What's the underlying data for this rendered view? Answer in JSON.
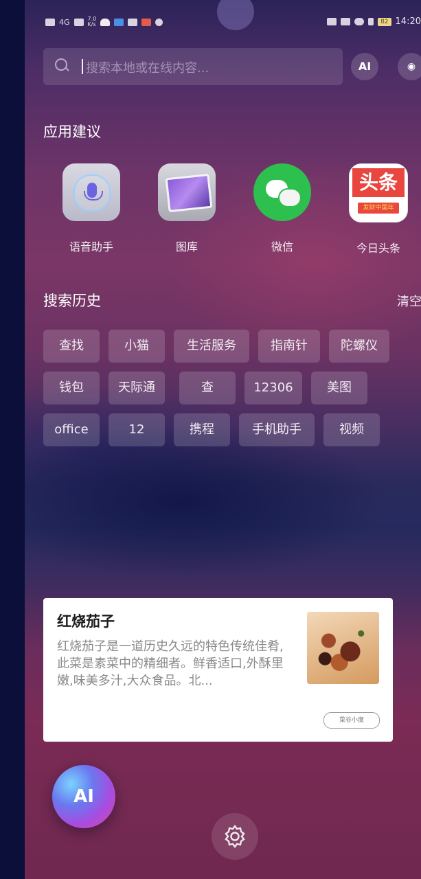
{
  "status_bar": {
    "left_text": "4G",
    "net_speed": "7.0\nK/s",
    "battery": "82",
    "time": "14:20"
  },
  "search": {
    "placeholder": "搜索本地或在线内容...",
    "ai_label": "AI",
    "right_icon": "eye-icon"
  },
  "app_suggestions": {
    "title": "应用建议",
    "apps": [
      {
        "label": "语音助手",
        "icon": "microphone-icon"
      },
      {
        "label": "图库",
        "icon": "gallery-icon"
      },
      {
        "label": "微信",
        "icon": "wechat-icon"
      },
      {
        "label": "今日头条",
        "icon": "toutiao-icon",
        "icon_text": "头条",
        "icon_subtext": "发财中国年"
      }
    ]
  },
  "history": {
    "title": "搜索历史",
    "clear_label": "清空",
    "items": [
      "查找",
      "小猫",
      "生活服务",
      "指南针",
      "陀螺仪",
      "钱包",
      "天际通",
      "查",
      "12306",
      "美图",
      "office",
      "12",
      "携程",
      "手机助手",
      "视频"
    ]
  },
  "card": {
    "title": "红烧茄子",
    "description": "红烧茄子是一道历史久远的特色传统佳肴,此菜是素菜中的精细者。鲜香适口,外酥里嫩,味美多汁,大众食品。北...",
    "source_label": "菜谷小度"
  },
  "assistant_button": {
    "label": "AI"
  },
  "settings": {
    "icon": "gear-icon"
  }
}
